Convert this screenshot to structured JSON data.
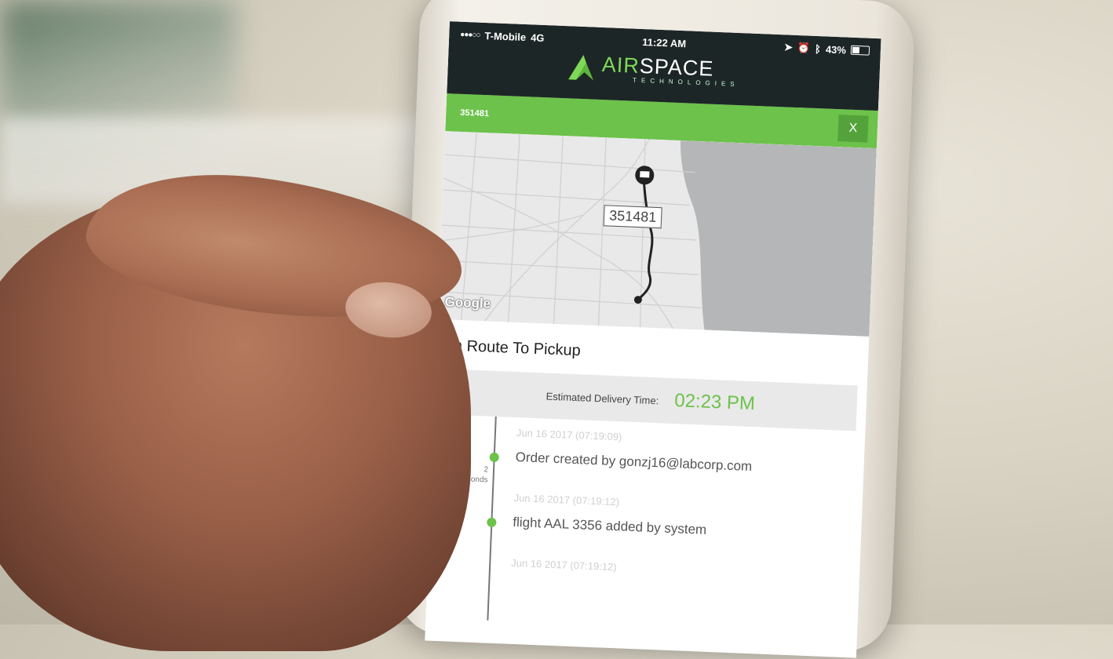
{
  "status_bar": {
    "carrier": "T-Mobile",
    "network": "4G",
    "time": "11:22 AM",
    "battery": "43%"
  },
  "brand": {
    "name_part1": "AIR",
    "name_part2": "SPACE",
    "tagline": "TECHNOLOGIES",
    "accent_color": "#7ed957",
    "header_color": "#1d2626"
  },
  "order_bar": {
    "order_id": "351481",
    "close_label": "X",
    "color": "#6cc24a"
  },
  "map": {
    "pin_label": "351481",
    "attribution": "Google"
  },
  "delivery": {
    "status_title": "In Route To Pickup",
    "eta_label": "Estimated Delivery Time:",
    "eta_time": "02:23 PM"
  },
  "timeline": [
    {
      "date": "Jun 16 2017 (07:19:09)",
      "text": "Order created by gonzj16@labcorp.com",
      "gap_value": "2",
      "gap_unit": "Seconds"
    },
    {
      "date": "Jun 16 2017 (07:19:12)",
      "text": "flight AAL 3356 added by system"
    },
    {
      "date": "Jun 16 2017 (07:19:12)",
      "text": ""
    }
  ]
}
